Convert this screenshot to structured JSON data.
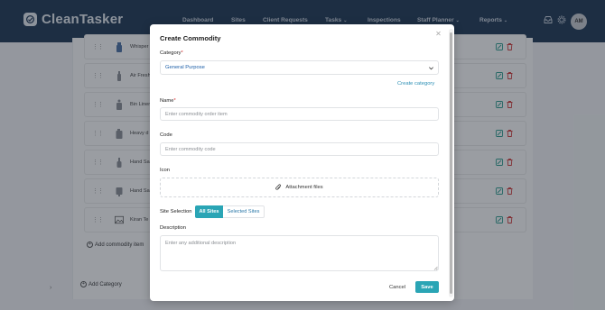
{
  "app": {
    "title": "CleanTasker"
  },
  "nav": {
    "items": [
      {
        "label": "Dashboard"
      },
      {
        "label": "Sites"
      },
      {
        "label": "Client Requests"
      },
      {
        "label": "Tasks",
        "dropdown": true
      },
      {
        "label": "Inspections"
      },
      {
        "label": "Staff Planner",
        "dropdown": true
      },
      {
        "label": "Reports",
        "dropdown": true
      }
    ],
    "avatar_initials": "AM"
  },
  "background": {
    "rows": [
      {
        "label": "Whisper",
        "icon": "sprayer-icon"
      },
      {
        "label": "Air Fresh",
        "icon": "bottle-icon"
      },
      {
        "label": "Bin Liner",
        "icon": "bin-icon"
      },
      {
        "label": "Heavy d",
        "icon": "canister-icon"
      },
      {
        "label": "Hand Sa",
        "icon": "pump-bottle-icon"
      },
      {
        "label": "Hand Sa",
        "icon": "dispenser-icon"
      },
      {
        "label": "Kiran Te",
        "icon": "image-icon"
      }
    ],
    "add_item_label": "Add commodity item",
    "add_category_label": "Add Category"
  },
  "modal": {
    "title": "Create Commodity",
    "category": {
      "label": "Category",
      "required_mark": "*",
      "value": "General Purpose",
      "create_link": "Create category"
    },
    "name": {
      "label": "Name",
      "required_mark": "*",
      "placeholder": "Enter commodity order item"
    },
    "code": {
      "label": "Code",
      "placeholder": "Enter commodity code"
    },
    "icon": {
      "label": "Icon",
      "button_label": "Attachment files"
    },
    "site_selection": {
      "label": "Site Selection",
      "options": [
        "All Sites",
        "Selected Sites"
      ],
      "selected": "All Sites"
    },
    "description": {
      "label": "Description",
      "placeholder": "Enter any additional description"
    },
    "cancel_label": "Cancel",
    "save_label": "Save"
  },
  "colors": {
    "navbar": "#1c3553",
    "accent": "#2aa5b5",
    "link": "#2c8fb5",
    "danger": "#d33b3b",
    "edit": "#2a9d8f"
  }
}
